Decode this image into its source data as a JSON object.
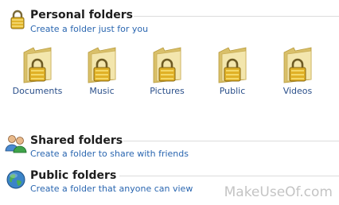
{
  "sections": {
    "personal": {
      "title": "Personal folders",
      "subtitle": "Create a folder just for you",
      "folders": [
        {
          "label": "Documents"
        },
        {
          "label": "Music"
        },
        {
          "label": "Pictures"
        },
        {
          "label": "Public"
        },
        {
          "label": "Videos"
        }
      ]
    },
    "shared": {
      "title": "Shared folders",
      "subtitle": "Create a folder to share with friends"
    },
    "public": {
      "title": "Public folders",
      "subtitle": "Create a folder that anyone can view"
    }
  },
  "icons": {
    "personal": "padlock-icon",
    "shared": "users-icon",
    "public": "globe-icon",
    "folder": "locked-folder-icon"
  },
  "colors": {
    "title": "#1e1e1e",
    "link": "#2a66b0",
    "folder_label": "#2a4f8a",
    "rule": "#dcdcdc",
    "folder_body": "#e9d68c",
    "lock": "#c9a21e"
  },
  "watermark": "MakeUseOf.com"
}
